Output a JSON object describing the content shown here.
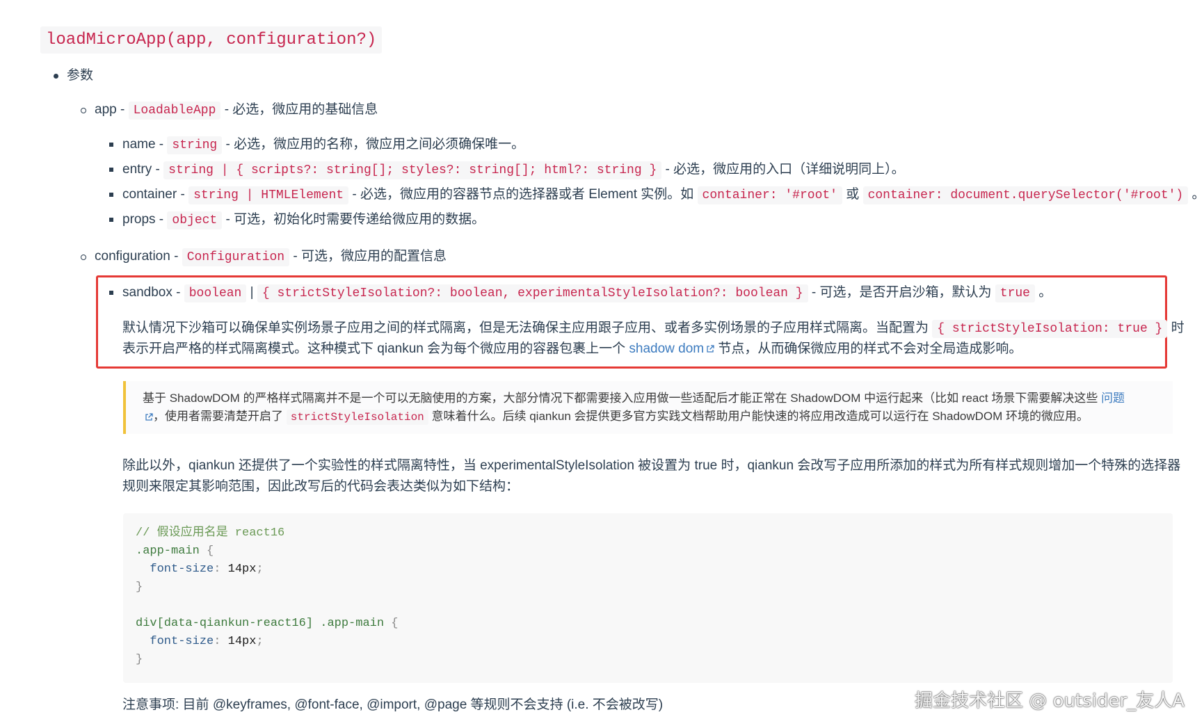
{
  "heading": "loadMicroApp(app, configuration?)",
  "params_label": "参数",
  "app": {
    "name": "app",
    "dash": "-",
    "type": "LoadableApp",
    "desc": "- 必选，微应用的基础信息"
  },
  "app_fields": [
    {
      "name": "name -",
      "type": "string",
      "desc": "- 必选，微应用的名称，微应用之间必须确保唯一。"
    },
    {
      "name": "entry -",
      "type": "string | { scripts?: string[]; styles?: string[]; html?: string }",
      "desc": "- 必选，微应用的入口（详细说明同上）。"
    },
    {
      "name": "container -",
      "type": "string | HTMLElement",
      "desc": "- 必选，微应用的容器节点的选择器或者 Element 实例。如",
      "example1": "container: '#root'",
      "or": "或",
      "example2": "container: document.querySelector('#root')",
      "end": "。"
    },
    {
      "name": "props -",
      "type": "object",
      "desc": "- 可选，初始化时需要传递给微应用的数据。"
    }
  ],
  "configuration": {
    "name": "configuration -",
    "type": "Configuration",
    "desc": "- 可选，微应用的配置信息"
  },
  "sandbox": {
    "name": "sandbox -",
    "type1": "boolean",
    "pipe": "|",
    "type2": "{ strictStyleIsolation?: boolean, experimentalStyleIsolation?: boolean }",
    "desc": "- 可选，是否开启沙箱，默认为",
    "default": "true",
    "end": "。",
    "para1_a": "默认情况下沙箱可以确保单实例场景子应用之间的样式隔离，但是无法确保主应用跟子应用、或者多实例场景的子应用样式隔离。当配置为",
    "para1_code": "{ strictStyleIsolation: true }",
    "para1_b": "时",
    "para2_a": "表示开启严格的样式隔离模式。这种模式下 qiankun 会为每个微应用的容器包裹上一个",
    "para2_link": "shadow dom",
    "para2_b": "节点，从而确保微应用的样式不会对全局造成影响。"
  },
  "tip": {
    "line1_a": "基于 ShadowDOM 的严格样式隔离并不是一个可以无脑使用的方案，大部分情况下都需要接入应用做一些适配后才能正常在 ShadowDOM 中运行起来（比如 react 场景下需要解决这些",
    "line1_link": "问题",
    "line2_a": "，使用者需要清楚开启了",
    "line2_code": "strictStyleIsolation",
    "line2_b": "意味着什么。后续 qiankun 会提供更多官方实践文档帮助用户能快速的将应用改造成可以运行在 ShadowDOM 环境的微应用。"
  },
  "experimental": {
    "line1": "除此以外，qiankun 还提供了一个实验性的样式隔离特性，当 experimentalStyleIsolation 被设置为 true 时，qiankun 会改写子应用所添加的样式为所有样式规则增加一个特殊的选择器",
    "line2": "规则来限定其影响范围，因此改写后的代码会表达类似为如下结构："
  },
  "code_lines": {
    "l1": "// 假设应用名是 react16",
    "l2_sel": ".app-main",
    "l2_brace": " {",
    "l3_prop": "  font-size",
    "l3_colon": ": ",
    "l3_val": "14px",
    "l3_semi": ";",
    "l4": "}",
    "l6_sel": "div[data-qiankun-react16] .app-main",
    "l6_brace": " {",
    "l7_prop": "  font-size",
    "l7_colon": ": ",
    "l7_val": "14px",
    "l7_semi": ";",
    "l8": "}"
  },
  "note": "注意事项: 目前 @keyframes, @font-face, @import, @page 等规则不会支持 (i.e. 不会被改写)",
  "watermark": "掘金技术社区 @ outsider_友人A"
}
